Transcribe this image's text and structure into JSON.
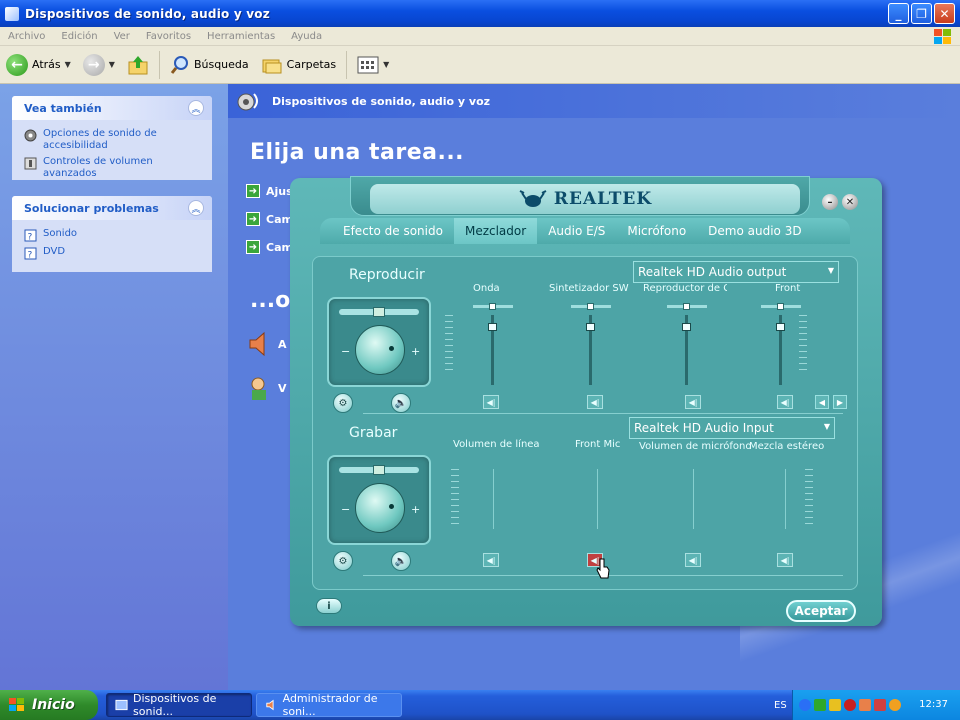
{
  "window": {
    "title": "Dispositivos de sonido, audio y voz"
  },
  "menu": {
    "items": [
      "Archivo",
      "Edición",
      "Ver",
      "Favoritos",
      "Herramientas",
      "Ayuda"
    ]
  },
  "toolbar": {
    "back_label": "Atrás",
    "search_label": "Búsqueda",
    "folders_label": "Carpetas"
  },
  "sidebar": {
    "see_also": {
      "title": "Vea también",
      "items": [
        "Opciones de sonido de accesibilidad",
        "Controles de volumen avanzados"
      ]
    },
    "troubleshoot": {
      "title": "Solucionar problemas",
      "items": [
        "Sonido",
        "DVD"
      ]
    }
  },
  "main": {
    "header": "Dispositivos de sonido, audio y voz",
    "pick_task": "Elija una tarea...",
    "tasks": [
      "Ajus",
      "Cam",
      "Cam"
    ],
    "or_pick": "...o",
    "cp_icons": [
      "A",
      "V"
    ]
  },
  "realtek": {
    "brand": "REALTEK",
    "tabs": [
      "Efecto de sonido",
      "Mezclador",
      "Audio E/S",
      "Micrófono",
      "Demo audio 3D"
    ],
    "active_tab": "Mezclador",
    "playback": {
      "label": "Reproducir",
      "device": "Realtek HD Audio output",
      "channels": [
        "Onda",
        "Sintetizador SW",
        "Reproductor de CD",
        "Front"
      ]
    },
    "record": {
      "label": "Grabar",
      "device": "Realtek HD Audio Input",
      "channels": [
        "Volumen de línea",
        "Front Mic",
        "Volumen de micrófono",
        "Mezcla estéreo"
      ]
    },
    "accept_label": "Aceptar"
  },
  "taskbar": {
    "start_label": "Inicio",
    "tasks": [
      "Dispositivos de sonid...",
      "Administrador de soni..."
    ],
    "language": "ES",
    "clock": "12:37"
  }
}
